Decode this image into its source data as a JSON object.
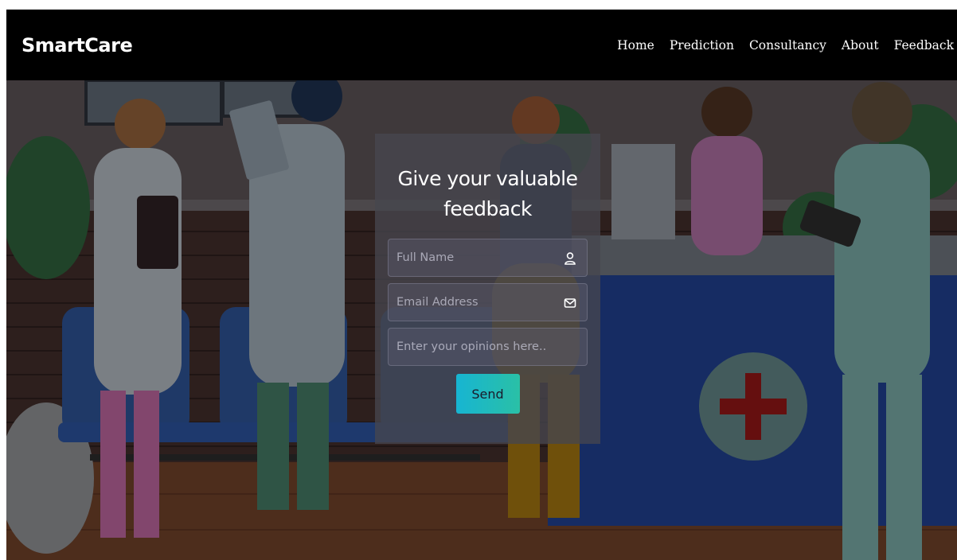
{
  "header": {
    "brand": "SmartCare",
    "nav": [
      "Home",
      "Prediction",
      "Consultancy",
      "About",
      "Feedback"
    ]
  },
  "form": {
    "title_line1": "Give your valuable",
    "title_line2": "feedback",
    "name_placeholder": "Full Name",
    "email_placeholder": "Email Address",
    "opinion_placeholder": "Enter your opinions here..",
    "send_label": "Send"
  },
  "icons": {
    "name": "user-icon",
    "email": "envelope-icon"
  },
  "colors": {
    "navbar": "#000000",
    "card": "#46464e",
    "button_start": "#17b5d2",
    "button_end": "#2ac0a6"
  }
}
